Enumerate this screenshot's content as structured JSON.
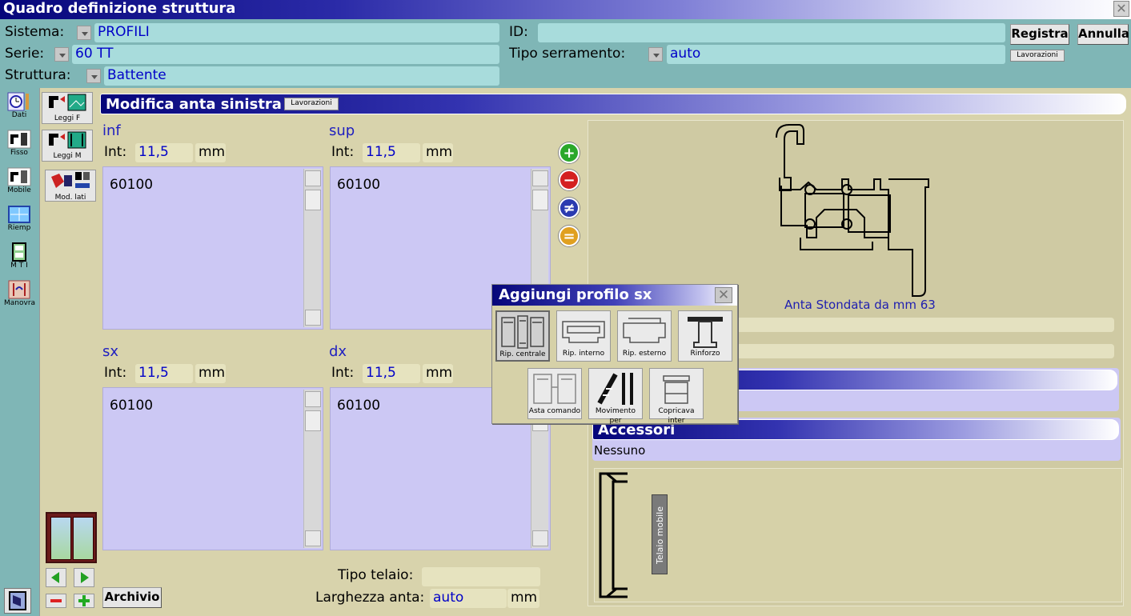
{
  "window": {
    "title": "Quadro definizione struttura"
  },
  "header": {
    "sistema_label": "Sistema:",
    "sistema_value": "PROFILI",
    "serie_label": "Serie:",
    "serie_value": "60 TT",
    "struttura_label": "Struttura:",
    "struttura_value": "Battente",
    "id_label": "ID:",
    "id_value": "",
    "tipo_serramento_label": "Tipo serramento:",
    "tipo_serramento_value": "auto",
    "registra_label": "Registra",
    "annulla_label": "Annulla",
    "lavorazioni_label": "Lavorazioni"
  },
  "toolbar": {
    "left": [
      {
        "label": "Dati",
        "icon": "clock-icon"
      },
      {
        "label": "Fisso",
        "icon": "frame-icon"
      },
      {
        "label": "Mobile",
        "icon": "sash-icon"
      },
      {
        "label": "Riemp",
        "icon": "glass-icon"
      },
      {
        "label": "M T I",
        "icon": "mti-icon"
      },
      {
        "label": "Manovra",
        "icon": "handle-icon"
      }
    ],
    "right": [
      {
        "label": "Leggi F",
        "icon": "read-frame-icon"
      },
      {
        "label": "Leggi M",
        "icon": "read-sash-icon"
      },
      {
        "label": "Mod. lati",
        "icon": "edit-sides-icon"
      }
    ]
  },
  "section": {
    "title": "Modifica anta sinistra",
    "lavorazioni_label": "Lavorazioni"
  },
  "sides": [
    {
      "name": "inf",
      "int_label": "Int:",
      "int_value": "11,5",
      "unit": "mm",
      "items": [
        "60100"
      ]
    },
    {
      "name": "sup",
      "int_label": "Int:",
      "int_value": "11,5",
      "unit": "mm",
      "items": [
        "60100"
      ]
    },
    {
      "name": "sx",
      "int_label": "Int:",
      "int_value": "11,5",
      "unit": "mm",
      "items": [
        "60100"
      ]
    },
    {
      "name": "dx",
      "int_label": "Int:",
      "int_value": "11,5",
      "unit": "mm",
      "items": [
        "60100"
      ]
    }
  ],
  "side_buttons": [
    "add-icon",
    "remove-icon",
    "not-equal-icon",
    "equal-icon"
  ],
  "profile": {
    "caption": "Anta Stondata da mm 63"
  },
  "accessori": {
    "title": "Accessori",
    "value": "Nessuno"
  },
  "telaio_mobile_label": "Telaio mobile",
  "bottom": {
    "tipo_telaio_label": "Tipo telaio:",
    "tipo_telaio_value": "",
    "larghezza_label": "Larghezza anta:",
    "larghezza_value": "auto",
    "larghezza_unit": "mm",
    "archivio_label": "Archivio"
  },
  "popup": {
    "title": "Aggiungi profilo sx",
    "row1": [
      "Rip. centrale",
      "Rip. interno",
      "Rip. esterno",
      "Rinforzo"
    ],
    "row2": [
      "Asta comando",
      "Movimento per",
      "Copricava inter"
    ]
  },
  "colors": {
    "title_start": "#06067a",
    "field_bg": "#a8dcdc",
    "value_text": "#0000c8",
    "list_bg": "#ccc8f4",
    "panel_bg": "#d8d3ac"
  }
}
